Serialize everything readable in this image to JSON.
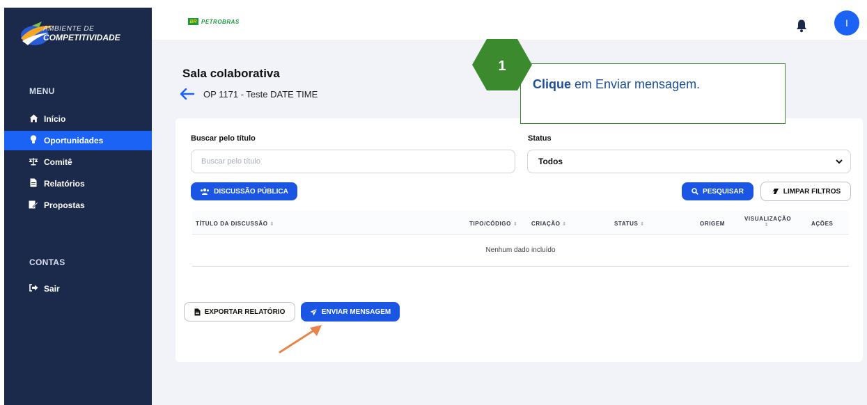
{
  "brand": {
    "logo_small": "AMBIENTE DE",
    "logo_big": "COMPETITIVIDADE",
    "partner_mark": "BR",
    "partner_name": "PETROBRAS"
  },
  "sidebar": {
    "menu_heading": "MENU",
    "items": [
      {
        "label": "Início",
        "icon": "home-icon"
      },
      {
        "label": "Oportunidades",
        "icon": "lightbulb-icon",
        "active": true
      },
      {
        "label": "Comitê",
        "icon": "scales-icon"
      },
      {
        "label": "Relatórios",
        "icon": "file-icon"
      },
      {
        "label": "Propostas",
        "icon": "signature-icon"
      }
    ],
    "accounts_heading": "CONTAS",
    "logout": {
      "label": "Sair",
      "icon": "sign-out-icon"
    }
  },
  "header": {
    "avatar_initial": "I",
    "bell_icon": "bell-icon"
  },
  "page": {
    "title": "Sala colaborativa",
    "subtitle": "OP 1171 - Teste DATE TIME"
  },
  "filters": {
    "search_label": "Buscar pelo título",
    "search_placeholder": "Buscar pelo título",
    "search_value": "",
    "status_label": "Status",
    "status_value": "Todos"
  },
  "buttons": {
    "public_discussion": "DISCUSSÃO PÚBLICA",
    "search": "PESQUISAR",
    "clear_filters": "LIMPAR FILTROS",
    "export_report": "EXPORTAR RELATÓRIO",
    "send_message": "ENVIAR MENSAGEM"
  },
  "table": {
    "columns": [
      "TÍTULO DA DISCUSSÃO",
      "TIPO/CÓDIGO",
      "CRIAÇÃO",
      "STATUS",
      "ORIGEM",
      "VISUALIZAÇÃO",
      "AÇÕES"
    ],
    "sortable": [
      true,
      true,
      true,
      true,
      false,
      true,
      false
    ],
    "empty_message": "Nenhum dado incluído"
  },
  "tutorial": {
    "step": "1",
    "instruction_bold": "Clique",
    "instruction_rest": " em Enviar mensagem.",
    "accent_color": "#3c8a2e",
    "arrow_color": "#e8844a"
  },
  "colors": {
    "sidebar": "#1b2a4a",
    "primary": "#1a55e3",
    "active_item": "#1a63f5"
  }
}
